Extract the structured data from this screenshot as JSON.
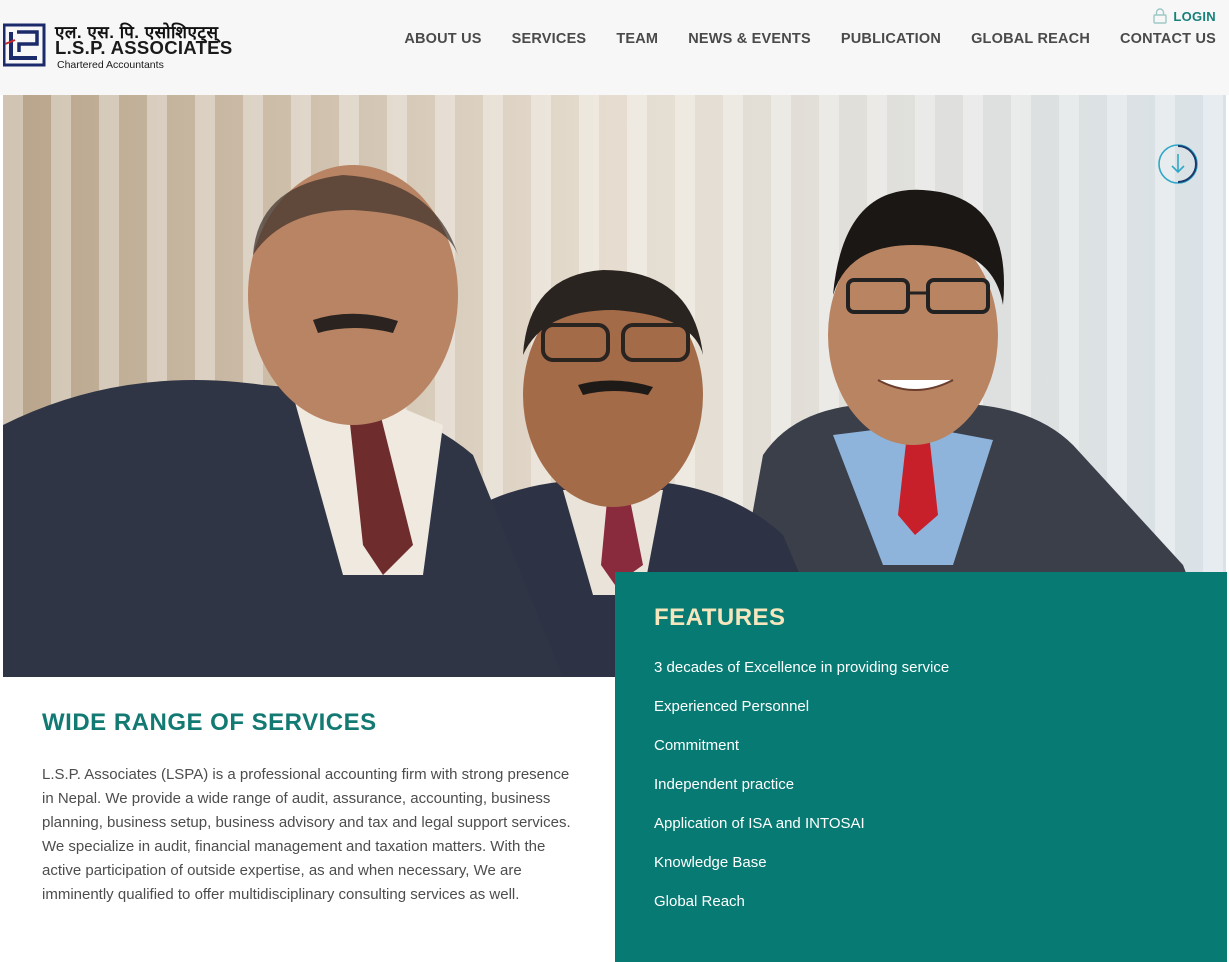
{
  "header": {
    "logo": {
      "devanagari": "एल. एस. पि. एसोशिएट्स्",
      "name": "L.S.P. ASSOCIATES",
      "subtitle": "Chartered Accountants"
    },
    "login_label": "LOGIN",
    "nav": [
      {
        "label": "ABOUT US"
      },
      {
        "label": "SERVICES"
      },
      {
        "label": "TEAM"
      },
      {
        "label": "NEWS & EVENTS"
      },
      {
        "label": "PUBLICATION"
      },
      {
        "label": "GLOBAL REACH"
      },
      {
        "label": "CONTACT US"
      }
    ]
  },
  "hero": {
    "scroll_icon": "arrow-down-circle-icon"
  },
  "services": {
    "title": "WIDE RANGE OF SERVICES",
    "text": "L.S.P. Associates (LSPA) is a professional accounting firm with strong presence in Nepal.  We provide a wide range of audit, assurance, accounting, business planning, business setup, business advisory and tax and legal support services. We specialize in audit, financial management and taxation matters. With the active participation of outside expertise, as and when necessary, We are imminently qualified to offer multidisciplinary consulting services as well."
  },
  "features": {
    "title": "FEATURES",
    "items": [
      "3 decades of Excellence in providing service",
      "Experienced Personnel",
      "Commitment",
      "Independent practice",
      "Application of ISA and INTOSAI",
      "Knowledge Base",
      "Global Reach"
    ]
  },
  "colors": {
    "teal": "#077a73",
    "teal_text": "#137a73",
    "cream": "#f6e6be",
    "header_bg": "#f7f7f7"
  }
}
